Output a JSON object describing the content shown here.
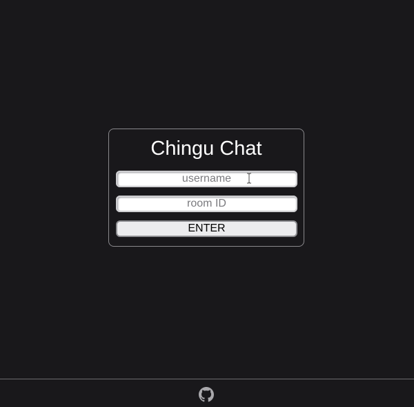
{
  "app": {
    "title": "Chingu Chat"
  },
  "login": {
    "username_placeholder": "username",
    "username_value": "",
    "room_placeholder": "room ID",
    "room_value": "",
    "enter_label": "ENTER"
  },
  "footer": {
    "link_icon": "github-icon"
  },
  "colors": {
    "background": "#19181b",
    "card_border": "#8a898d",
    "title_text": "#ffffff",
    "button_bg": "#ececee"
  }
}
